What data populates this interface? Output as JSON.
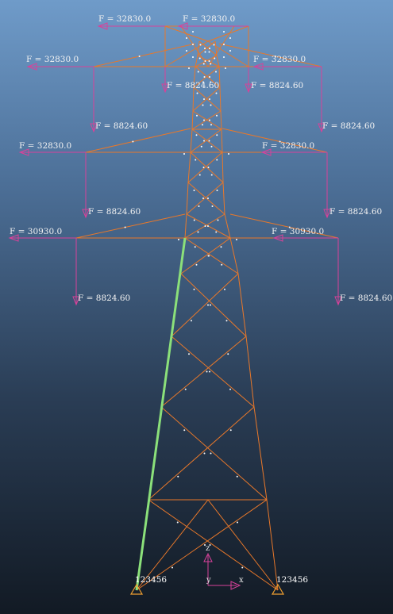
{
  "loads": [
    {
      "label": "F = 32830.0"
    },
    {
      "label": "F = 32830.0"
    },
    {
      "label": "F = 32830.0"
    },
    {
      "label": "F = 32830.0"
    },
    {
      "label": "F = 8824.60"
    },
    {
      "label": "F = 8824.60"
    },
    {
      "label": "F = 8824.60"
    },
    {
      "label": "F = 8824.60"
    },
    {
      "label": "F = 32830.0"
    },
    {
      "label": "F = 32830.0"
    },
    {
      "label": "F = 8824.60"
    },
    {
      "label": "F = 8824.60"
    },
    {
      "label": "F = 30930.0"
    },
    {
      "label": "F = 30930.0"
    },
    {
      "label": "F = 8824.60"
    },
    {
      "label": "F = 8824.60"
    }
  ],
  "supports": [
    {
      "label": "123456"
    },
    {
      "label": "123456"
    }
  ],
  "axes": {
    "z": "z",
    "x": "x",
    "y": "y"
  },
  "colors": {
    "member": "#e8782a",
    "selected_member": "#8be07a",
    "load_arrow": "#d8429a",
    "node": "#ffffff",
    "support": "#f0a030"
  }
}
